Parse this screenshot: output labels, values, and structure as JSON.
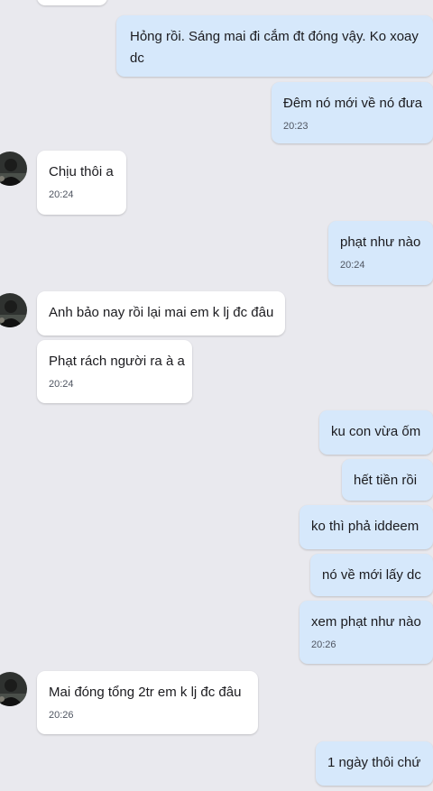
{
  "messages": [
    {
      "dir": "in",
      "text": "",
      "time": ""
    },
    {
      "dir": "out",
      "text": "Hỏng rồi. Sáng mai đi cắm đt đóng vậy. Ko xoay dc",
      "time": ""
    },
    {
      "dir": "out",
      "text": "Đêm nó mới về nó đưa",
      "time": "20:23"
    },
    {
      "dir": "in",
      "text": "Chịu thôi a",
      "time": "20:24"
    },
    {
      "dir": "out",
      "text": "phạt như nào",
      "time": "20:24"
    },
    {
      "dir": "in",
      "text": "Anh bảo nay rồi lại mai em k lj đc đâu",
      "time": ""
    },
    {
      "dir": "in",
      "text": "Phạt rách người ra à a",
      "time": "20:24"
    },
    {
      "dir": "out",
      "text": "ku con vừa ốm",
      "time": ""
    },
    {
      "dir": "out",
      "text": "hết tiền rồi",
      "time": ""
    },
    {
      "dir": "out",
      "text": "ko thì phả iddeem",
      "time": ""
    },
    {
      "dir": "out",
      "text": "nó về mới lấy dc",
      "time": ""
    },
    {
      "dir": "out",
      "text": "xem phạt như nào",
      "time": "20:26"
    },
    {
      "dir": "in",
      "text": "Mai đóng tổng 2tr em k lj đc đâu",
      "time": "20:26"
    },
    {
      "dir": "out",
      "text": "1 ngày thôi chứ",
      "time": ""
    }
  ]
}
